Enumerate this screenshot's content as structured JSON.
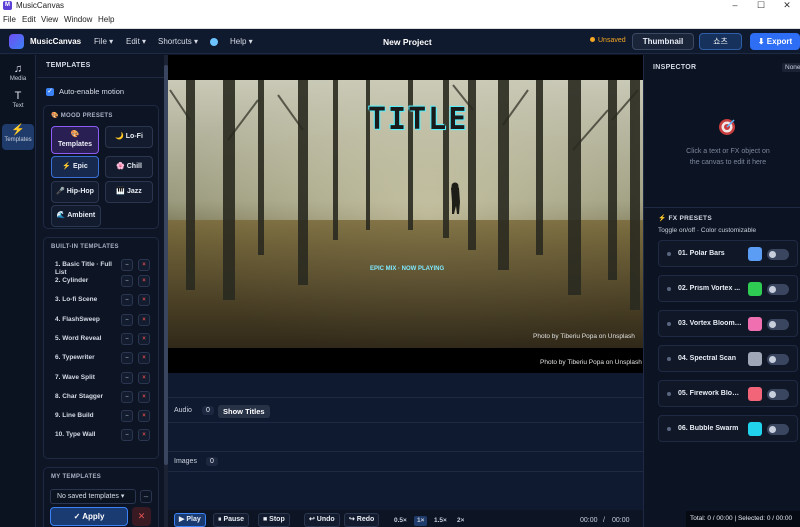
{
  "window": {
    "title": "MusicCanvas",
    "controls": [
      "–",
      "☐",
      "✕"
    ]
  },
  "menubar": [
    "File",
    "Edit",
    "View",
    "Window",
    "Help"
  ],
  "header": {
    "brand": "MusicCanvas",
    "menus": [
      "File ▾",
      "Edit ▾",
      "Shortcuts ▾",
      "Help ▾"
    ],
    "project_title": "New Project",
    "unsaved": "Unsaved",
    "thumbnail": "Thumbnail",
    "soz": "쇼츠",
    "export": "Export"
  },
  "rail": [
    {
      "icon": "♫",
      "label": "Media"
    },
    {
      "icon": "T",
      "label": "Text"
    },
    {
      "icon": "⚡",
      "label": "Templates"
    }
  ],
  "left": {
    "heading": "TEMPLATES",
    "auto_motion": "Auto-enable motion",
    "mood_heading": "MOOD PRESETS",
    "moods": [
      {
        "icon": "🎨",
        "label": "Templates"
      },
      {
        "icon": "🌙",
        "label": "Lo-Fi"
      },
      {
        "icon": "⚡",
        "label": "Epic"
      },
      {
        "icon": "🌸",
        "label": "Chill"
      },
      {
        "icon": "🎤",
        "label": "Hip-Hop"
      },
      {
        "icon": "🎹",
        "label": "Jazz"
      },
      {
        "icon": "🌊",
        "label": "Ambient"
      }
    ],
    "builtin_heading": "BUILT-IN TEMPLATES",
    "builtin": [
      "1. Basic Title · Full List",
      "2. Cylinder",
      "3. Lo-fi Scene",
      "4. FlashSweep",
      "5. Word Reveal",
      "6. Typewriter",
      "7. Wave Split",
      "8. Char Stagger",
      "9. Line Build",
      "10. Type Wall"
    ],
    "my_heading": "MY TEMPLATES",
    "saved_select": "No saved templates",
    "apply": "✓ Apply",
    "apply_x": "✕"
  },
  "stage": {
    "title": "TITLE",
    "subtitle": "EPIC MIX · NOW PLAYING",
    "credit_inner": "Photo by Tiberiu Popa on Unsplash",
    "credit_outer": "Photo by Tiberiu Popa on Unsplash"
  },
  "tracks": {
    "audio_label": "Audio",
    "audio_count": "0",
    "show_titles": "Show Titles",
    "images_label": "Images",
    "images_count": "0"
  },
  "transport": {
    "play": "▶ Play",
    "pause": "⏸ Pause",
    "stop": "■ Stop",
    "undo": "↩ Undo",
    "redo": "↪ Redo",
    "speeds": [
      "0.5×",
      "1×",
      "1.5×",
      "2×"
    ],
    "selected_speed": "1×",
    "time_current": "00:00",
    "time_total": "00:00"
  },
  "inspector": {
    "heading": "INSPECTOR",
    "none": "None",
    "hint": "Click a text or FX object on the canvas to edit it here",
    "fx_heading": "FX PRESETS",
    "fx_sub": "Toggle on/off · Color customizable",
    "fx": [
      {
        "name": "01. Polar Bars",
        "color": "#5b9cf5"
      },
      {
        "name": "02. Prism Vortex ...",
        "color": "#2ecc52"
      },
      {
        "name": "03. Vortex Bloom ...",
        "color": "#f06fb0"
      },
      {
        "name": "04. Spectral Scan",
        "color": "#a0a8b8"
      },
      {
        "name": "05. Firework Bloom",
        "color": "#f26478"
      },
      {
        "name": "06. Bubble Swarm",
        "color": "#22d3ee"
      }
    ]
  },
  "status": "Total: 0 / 00:00 | Selected: 0 / 00:00",
  "colors": {
    "accent": "#3b82f6",
    "purple": "#8c5cf6",
    "unsaved": "#f5a623"
  }
}
